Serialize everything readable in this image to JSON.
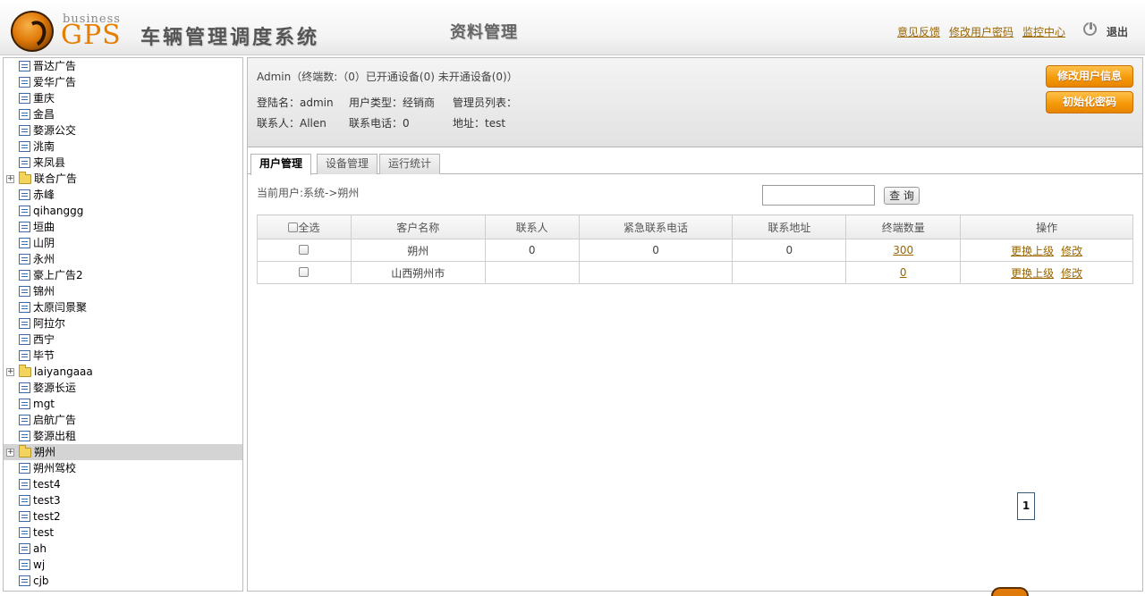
{
  "header": {
    "logo_business": "business",
    "logo_gps": "GPS",
    "system_title": "车辆管理调度系统",
    "module_title": "资料管理",
    "links": [
      "意见反馈",
      "修改用户密码",
      "监控中心"
    ],
    "logout": "退出"
  },
  "sidebar": {
    "items": [
      {
        "label": "晋达广告",
        "type": "doc"
      },
      {
        "label": "爱华广告",
        "type": "doc"
      },
      {
        "label": "重庆",
        "type": "doc"
      },
      {
        "label": "金昌",
        "type": "doc"
      },
      {
        "label": "婺源公交",
        "type": "doc"
      },
      {
        "label": "洮南",
        "type": "doc"
      },
      {
        "label": "来凤县",
        "type": "doc"
      },
      {
        "label": "联合广告",
        "type": "folder"
      },
      {
        "label": "赤峰",
        "type": "doc"
      },
      {
        "label": "qihanggg",
        "type": "doc"
      },
      {
        "label": "垣曲",
        "type": "doc"
      },
      {
        "label": "山阴",
        "type": "doc"
      },
      {
        "label": "永州",
        "type": "doc"
      },
      {
        "label": "豪上广告2",
        "type": "doc"
      },
      {
        "label": "锦州",
        "type": "doc"
      },
      {
        "label": "太原闫景聚",
        "type": "doc"
      },
      {
        "label": "阿拉尔",
        "type": "doc"
      },
      {
        "label": "西宁",
        "type": "doc"
      },
      {
        "label": "毕节",
        "type": "doc"
      },
      {
        "label": "laiyangaaa",
        "type": "folder"
      },
      {
        "label": "婺源长运",
        "type": "doc"
      },
      {
        "label": "mgt",
        "type": "doc"
      },
      {
        "label": "启航广告",
        "type": "doc"
      },
      {
        "label": "婺源出租",
        "type": "doc"
      },
      {
        "label": "朔州",
        "type": "folder",
        "selected": true
      },
      {
        "label": "朔州驾校",
        "type": "doc"
      },
      {
        "label": "test4",
        "type": "doc"
      },
      {
        "label": "test3",
        "type": "doc"
      },
      {
        "label": "test2",
        "type": "doc"
      },
      {
        "label": "test",
        "type": "doc"
      },
      {
        "label": "ah",
        "type": "doc"
      },
      {
        "label": "wj",
        "type": "doc"
      },
      {
        "label": "cjb",
        "type": "doc"
      }
    ]
  },
  "info": {
    "summary": "Admin（终端数:（0）已开通设备(0)  未开通设备(0)）",
    "login_name": "登陆名：admin",
    "user_type": "用户类型：经销商",
    "admin_list": "管理员列表：",
    "contact": "联系人：Allen",
    "phone": "联系电话：0",
    "address": "地址：test",
    "btn_edit_user": "修改用户信息",
    "btn_reset_pwd": "初始化密码"
  },
  "tabs": [
    "用户管理",
    "设备管理",
    "运行统计"
  ],
  "breadcrumb": "当前用户:系统->朔州",
  "search": {
    "value": "",
    "button": "查 询"
  },
  "table": {
    "headers": [
      "全选",
      "客户名称",
      "联系人",
      "紧急联系电话",
      "联系地址",
      "终端数量",
      "操作"
    ],
    "rows": [
      [
        "朔州",
        "0",
        "0",
        "0",
        "300"
      ],
      [
        "山西朔州市",
        "",
        "",
        "",
        "0"
      ]
    ],
    "op_change_parent": "更换上级",
    "op_edit": "修改"
  },
  "pager": {
    "current": "1"
  }
}
